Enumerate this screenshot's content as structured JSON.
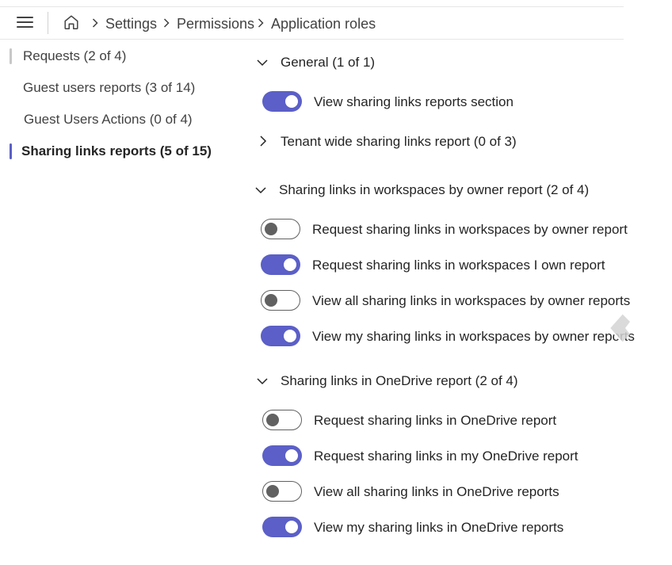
{
  "header": {
    "menu_icon": "hamburger-icon",
    "home_icon": "home-icon",
    "breadcrumb": [
      "Settings",
      "Permissions",
      "Application roles"
    ]
  },
  "sidebar": {
    "items": [
      {
        "label": "Requests (2 of 4)",
        "state": "marked"
      },
      {
        "label": "Guest users reports (3 of 14)",
        "state": "normal"
      },
      {
        "label": "Guest Users Actions (0 of 4)",
        "state": "normal"
      },
      {
        "label": "Sharing links reports (5 of 15)",
        "state": "active"
      }
    ]
  },
  "content": {
    "general": {
      "title": "General (1 of 1)",
      "expanded": true,
      "toggles": [
        {
          "label": "View sharing links reports section",
          "on": true
        }
      ]
    },
    "tenant": {
      "title": "Tenant wide sharing links report (0 of 3)",
      "expanded": false
    },
    "workspaces": {
      "title": "Sharing links in workspaces by owner report (2 of 4)",
      "expanded": true,
      "toggles": [
        {
          "label": "Request sharing links in workspaces by owner report",
          "on": false
        },
        {
          "label": "Request sharing links in workspaces I own report",
          "on": true
        },
        {
          "label": "View all sharing links in workspaces by owner reports",
          "on": false
        },
        {
          "label": "View my sharing links in workspaces by owner reports",
          "on": true
        }
      ]
    },
    "onedrive": {
      "title": "Sharing links in OneDrive report (2 of 4)",
      "expanded": true,
      "toggles": [
        {
          "label": "Request sharing links in OneDrive report",
          "on": false
        },
        {
          "label": "Request sharing links in my OneDrive report",
          "on": true
        },
        {
          "label": "View all sharing links in OneDrive reports",
          "on": false
        },
        {
          "label": "View my sharing links in OneDrive reports",
          "on": true
        }
      ]
    }
  },
  "colors": {
    "accent": "#5b5fc7",
    "toggle_off": "#616161",
    "active_indicator": "#5b5fc7",
    "marked_indicator": "#c8c8c8",
    "divider": "#e6e6e6"
  },
  "cursor_icon": "mouse-pointer-icon"
}
